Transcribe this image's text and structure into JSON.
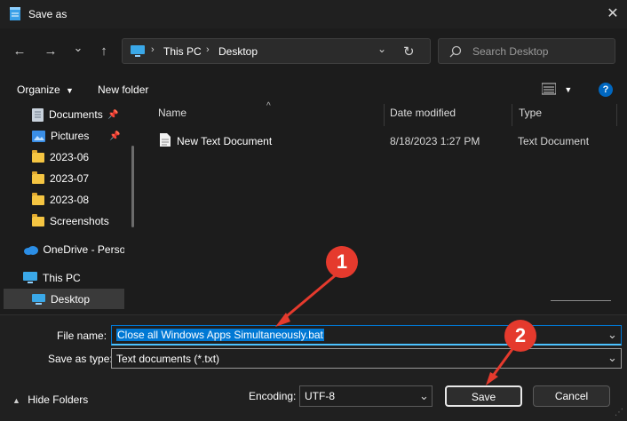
{
  "window": {
    "title": "Save as",
    "close_glyph": "✕"
  },
  "nav": {
    "back_glyph": "←",
    "forward_glyph": "→",
    "dropdown_glyph": "⌄",
    "up_glyph": "↑",
    "breadcrumb": [
      "This PC",
      "Desktop"
    ],
    "separator": "›",
    "refresh_glyph": "↻",
    "search_placeholder": "Search Desktop"
  },
  "toolbar": {
    "organize_label": "Organize",
    "new_folder_label": "New folder",
    "help_glyph": "?"
  },
  "sidebar": {
    "items": [
      {
        "label": "Documents",
        "icon": "documents-icon",
        "pinned": true
      },
      {
        "label": "Pictures",
        "icon": "pictures-icon",
        "pinned": true
      },
      {
        "label": "2023-06",
        "icon": "folder-icon"
      },
      {
        "label": "2023-07",
        "icon": "folder-icon"
      },
      {
        "label": "2023-08",
        "icon": "folder-icon"
      },
      {
        "label": "Screenshots",
        "icon": "folder-icon"
      },
      {
        "label": "OneDrive - Persor",
        "icon": "cloud-icon"
      },
      {
        "label": "This PC",
        "icon": "monitor-icon"
      },
      {
        "label": "Desktop",
        "icon": "desktop-icon",
        "selected": true
      }
    ]
  },
  "filelist": {
    "columns": [
      "Name",
      "Date modified",
      "Type"
    ],
    "rows": [
      {
        "name": "New Text Document",
        "date": "8/18/2023 1:27 PM",
        "type": "Text Document"
      }
    ]
  },
  "form": {
    "filename_label": "File name:",
    "filename_value": "Close all Windows Apps Simultaneously.bat",
    "savetype_label": "Save as type:",
    "savetype_value": "Text documents (*.txt)",
    "encoding_label": "Encoding:",
    "encoding_value": "UTF-8",
    "hide_folders_label": "Hide Folders",
    "save_label": "Save",
    "cancel_label": "Cancel"
  },
  "callouts": [
    "1",
    "2"
  ],
  "colors": {
    "accent": "#0067c0",
    "selection_bg": "#0078d4",
    "callout_red": "#e53a2d"
  }
}
